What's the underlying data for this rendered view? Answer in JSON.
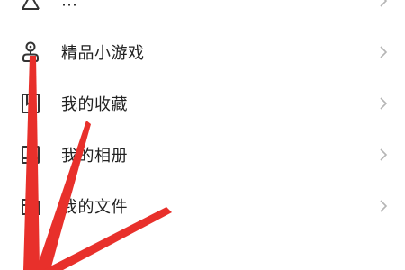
{
  "menu": {
    "items": [
      {
        "label": "…",
        "icon": "vip-download-icon"
      },
      {
        "label": "精品小游戏",
        "icon": "game-joystick-icon"
      },
      {
        "label": "我的收藏",
        "icon": "bookmark-icon"
      },
      {
        "label": "我的相册",
        "icon": "album-icon"
      },
      {
        "label": "我的文件",
        "icon": "folder-icon"
      }
    ],
    "icon_color": "#333333",
    "chevron_color": "#b5b5b5"
  },
  "annotations": {
    "arrow_color": "#e8302b"
  }
}
